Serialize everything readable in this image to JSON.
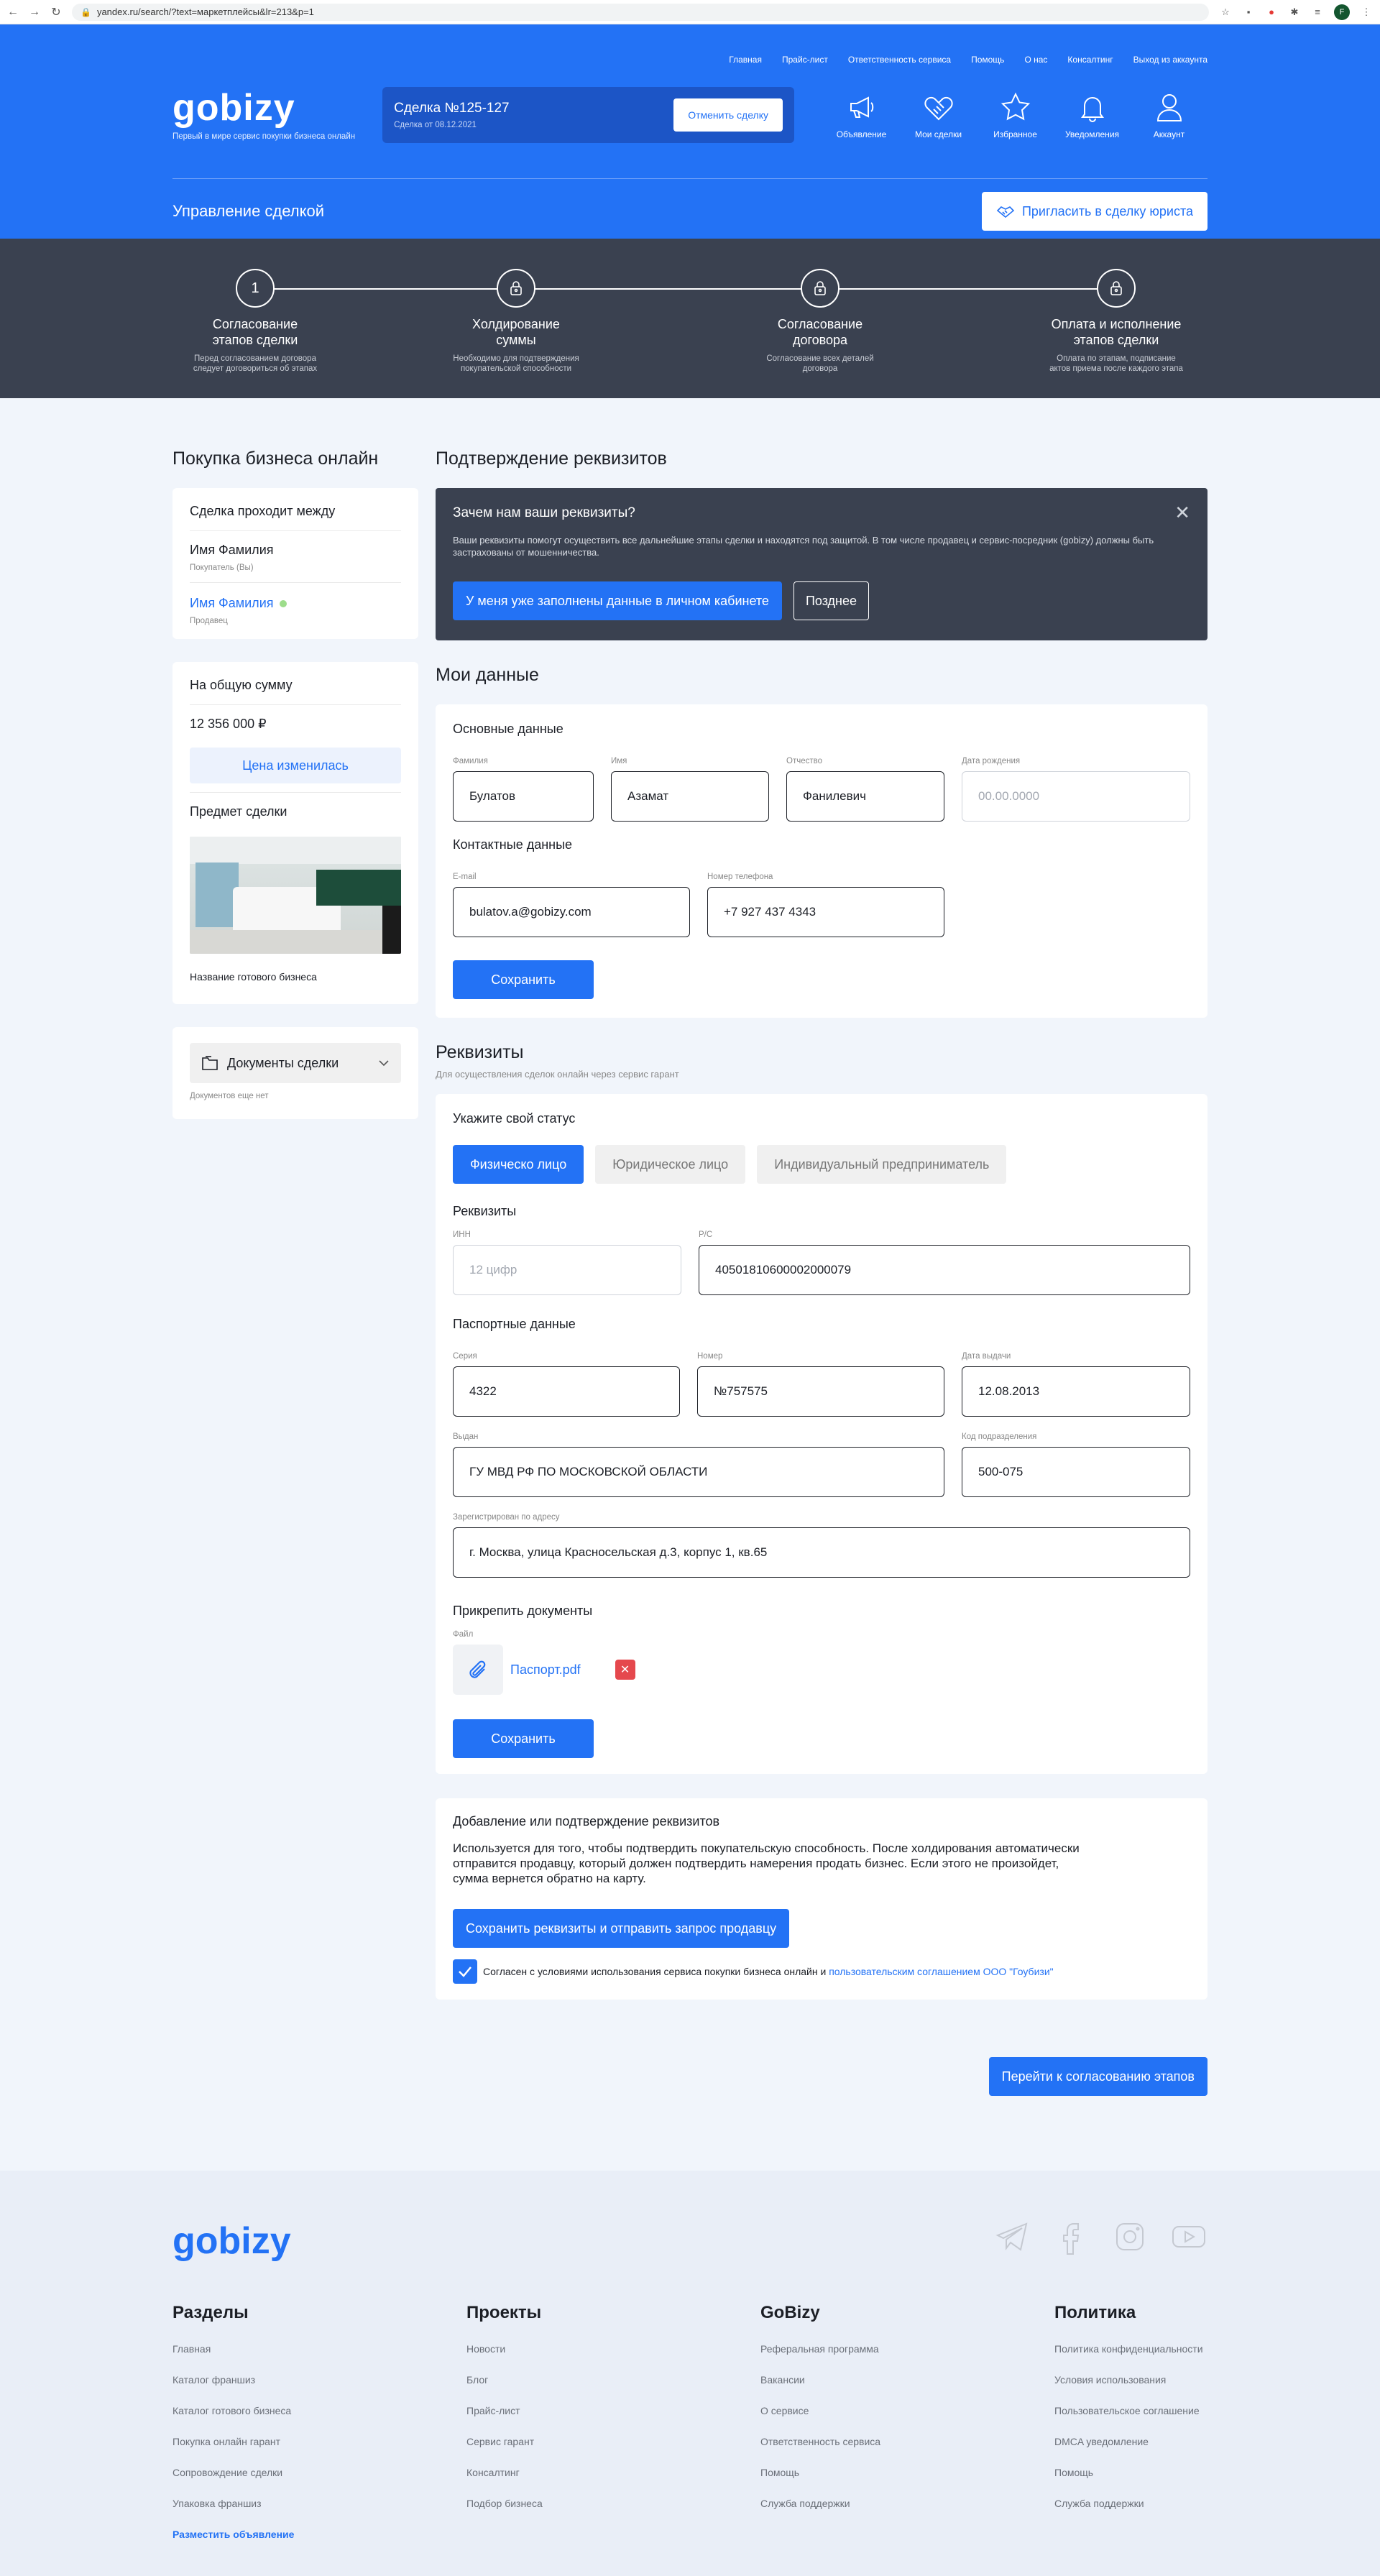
{
  "browser": {
    "url": "yandex.ru/search/?text=маркетплейсы&lr=213&p=1",
    "profile_initial": "F"
  },
  "topnav": [
    "Главная",
    "Прайс-лист",
    "Ответственность сервиса",
    "Помощь",
    "О нас",
    "Консалтинг",
    "Выход из аккаунта"
  ],
  "brand": {
    "name": "gobizy",
    "tagline": "Первый в мире сервис покупки бизнеса онлайн",
    "accent": "#2372f5",
    "dark": "#3a4150"
  },
  "deal": {
    "title": "Сделка №125-127",
    "date": "Сделка от 08.12.2021",
    "cancel_label": "Отменить сделку"
  },
  "header_icons": [
    {
      "icon": "megaphone-icon",
      "label": "Объявление"
    },
    {
      "icon": "handshake-icon",
      "label": "Мои сделки"
    },
    {
      "icon": "star-icon",
      "label": "Избранное"
    },
    {
      "icon": "bell-icon",
      "label": "Уведомления"
    },
    {
      "icon": "user-icon",
      "label": "Аккаунт"
    }
  ],
  "manage": {
    "title": "Управление сделкой",
    "invite_label": "Пригласить в сделку юриста"
  },
  "steps": [
    {
      "icon": "1",
      "name_1": "Согласование",
      "name_2": "этапов сделки",
      "desc_1": "Перед согласованием договора",
      "desc_2": "следует договориться об этапах"
    },
    {
      "icon": "lock",
      "name_1": "Холдирование",
      "name_2": "суммы",
      "desc_1": "Необходимо для подтверждения",
      "desc_2": "покупательской способности"
    },
    {
      "icon": "lock",
      "name_1": "Согласование",
      "name_2": "договора",
      "desc_1": "Согласование всех деталей",
      "desc_2": "договора"
    },
    {
      "icon": "lock",
      "name_1": "Оплата и исполнение",
      "name_2": "этапов сделки",
      "desc_1": "Оплата по этапам, подписание",
      "desc_2": "актов приема после каждого этапа"
    }
  ],
  "sidebar": {
    "title": "Покупка бизнеса онлайн",
    "parties_title": "Сделка проходит между",
    "buyer_name": "Имя Фамилия",
    "buyer_role": "Покупатель (Вы)",
    "seller_name": "Имя Фамилия",
    "seller_role": "Продавец",
    "total_label": "На общую сумму",
    "total_value": "12 356 000 ₽",
    "price_changed": "Цена изменилась",
    "subject_label": "Предмет сделки",
    "subject_name": "Название готового бизнеса",
    "docs_label": "Документы сделки",
    "docs_empty": "Документов еще нет"
  },
  "confirm": {
    "title": "Подтверждение реквизитов",
    "notice_title": "Зачем нам ваши реквизиты?",
    "notice_text": "Ваши реквизиты помогут осуществить все дальнейшие этапы сделки и находятся под защитой. В том числе продавец и сервис-посредник (gobizy) должны быть застрахованы от мошенничества.",
    "filled_label": "У меня уже заполнены данные в личном кабинете",
    "later_label": "Позднее"
  },
  "my_data": {
    "title": "Мои данные",
    "basic_title": "Основные данные",
    "surname_label": "Фамилия",
    "surname": "Булатов",
    "name_label": "Имя",
    "name": "Азамат",
    "patronymic_label": "Отчество",
    "patronymic": "Фанилевич",
    "birth_label": "Дата рождения",
    "birth_placeholder": "00.00.0000",
    "contacts_title": "Контактные данные",
    "email_label": "E-mail",
    "email": "bulatov.a@gobizy.com",
    "phone_label": "Номер телефона",
    "phone": "+7 927 437 4343",
    "save_label": "Сохранить"
  },
  "requisites": {
    "title": "Реквизиты",
    "subtitle": "Для осуществления сделок онлайн через сервис гарант",
    "status_title": "Укажите свой статус",
    "status_tabs": [
      "Физическо лицо",
      "Юридическое лицо",
      "Индивидуальный предприниматель"
    ],
    "req_title": "Реквизиты",
    "inn_label": "ИНН",
    "inn_placeholder": "12 цифр",
    "rs_label": "Р/С",
    "rs": "40501810600002000079",
    "passport_title": "Паспортные данные",
    "series_label": "Серия",
    "series": "4322",
    "number_label": "Номер",
    "number": "№757575",
    "issue_date_label": "Дата выдачи",
    "issue_date": "12.08.2013",
    "issued_by_label": "Выдан",
    "issued_by": "ГУ МВД РФ ПО МОСКОВСКОЙ ОБЛАСТИ",
    "division_label": "Код подразделения",
    "division": "500-075",
    "address_label": "Зарегистрирован по адресу",
    "address": "г. Москва, улица Красносельская д.3, корпус 1, кв.65",
    "attach_title": "Прикрепить документы",
    "file_label": "Файл",
    "file_name": "Паспорт.pdf",
    "save_label": "Сохранить"
  },
  "add_confirm": {
    "title": "Добавление или подтверждение реквизитов",
    "text_1": "Используется для того, чтобы подтвердить покупательскую способность. После холдирования автоматически",
    "text_2": "отправится продавцу, который должен подтвердить намерения продать бизнес. Если этого не произойдет,",
    "text_3": "сумма вернется обратно на карту.",
    "submit_label": "Сохранить реквизиты и отправить запрос продавцу",
    "agree_text": "Согласен с условиями использования сервиса покупки бизнеса онлайн и ",
    "agree_link": "пользовательским соглашением ООО \"Гоубизи\""
  },
  "next_label": "Перейти к согласованию этапов",
  "footer": {
    "logo": "gobizy",
    "socials": [
      "telegram-icon",
      "facebook-icon",
      "instagram-icon",
      "youtube-icon"
    ],
    "columns": [
      {
        "title": "Разделы",
        "items": [
          "Главная",
          "Каталог франшиз",
          "Каталог готового бизнеса",
          "Покупка онлайн гарант",
          "Сопровождение сделки",
          "Упаковка франшиз"
        ],
        "highlight": "Разместить объявление"
      },
      {
        "title": "Проекты",
        "items": [
          "Новости",
          "Блог",
          "Прайс-лист",
          "Сервис гарант",
          "Консалтинг",
          "Подбор бизнеса"
        ]
      },
      {
        "title": "GoBizy",
        "items": [
          "Реферальная программа",
          "Вакансии",
          "О сервисе",
          "Ответственность сервиса",
          "Помощь",
          "Служба поддержки"
        ]
      },
      {
        "title": "Политика",
        "items": [
          "Политика конфиденциальности",
          "Условия использования",
          "Пользовательское соглашение",
          "DMCA уведомление",
          "Помощь",
          "Служба поддержки"
        ]
      }
    ]
  }
}
